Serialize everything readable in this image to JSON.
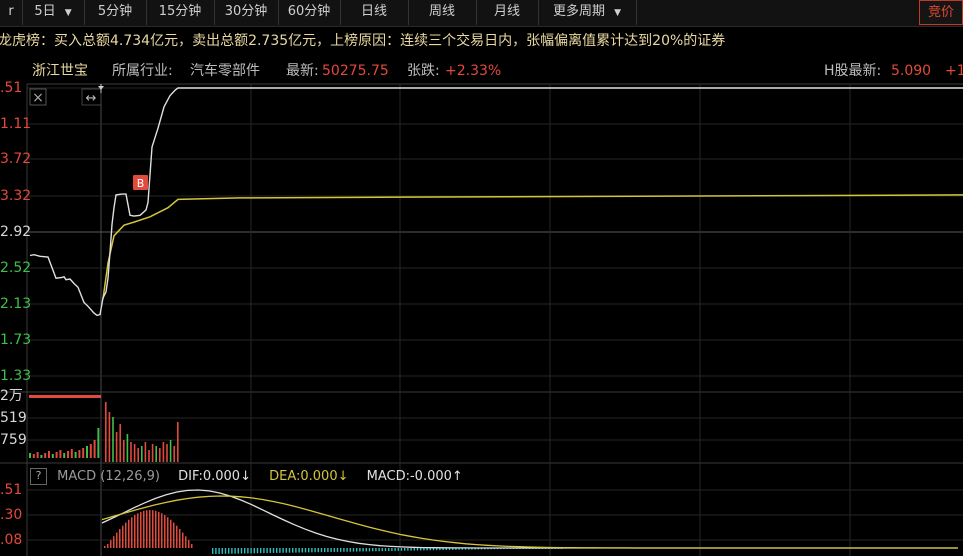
{
  "toolbar": {
    "first_fragment": "r",
    "period_selected": "5日",
    "items": [
      "5分钟",
      "15分钟",
      "30分钟",
      "60分钟",
      "日线",
      "周线",
      "月线",
      "更多周期"
    ],
    "right_button": "竞价"
  },
  "lhb": {
    "text": "龙虎榜：买入总额4.734亿元，卖出总额2.735亿元，上榜原因：连续三个交易日内，张幅偏离值累计达到20%的证券"
  },
  "stock": {
    "name": "浙江世宝",
    "industry_label": "所属行业:",
    "industry": "汽车零部件",
    "latest_label": "最新:",
    "latest": "50275.75",
    "change_label": "张跌:",
    "change": "+2.33%",
    "h_label": "H股最新:",
    "h_value": "5.090",
    "h_extra": "+1"
  },
  "price_axis": [
    ".51",
    "1.11",
    "3.72",
    "3.32",
    "2.92",
    "2.52",
    "2.13",
    "1.73",
    "1.33"
  ],
  "volume_axis": [
    "2万",
    "519",
    "759"
  ],
  "macd": {
    "label": "MACD (12,26,9)",
    "dif": "DIF:0.000↓",
    "dea": "DEA:0.000↓",
    "macd": "MACD:-0.000↑",
    "axis": [
      ".51",
      ".30",
      ".08"
    ]
  },
  "markers": {
    "buy": "B",
    "close": "×",
    "resize": "↔",
    "help": "?"
  },
  "colors": {
    "up": "#e24a3b",
    "down": "#2fbfbf",
    "avg_line": "#d4c53a",
    "price_line": "#e0e0e0",
    "lhb_text": "#e9d8a0",
    "name": "#e9d8a0"
  },
  "chart_data": {
    "type": "line",
    "title": "浙江世宝",
    "price_series": {
      "name": "price",
      "values": [
        2.92,
        2.93,
        2.91,
        2.9,
        2.62,
        2.63,
        2.64,
        2.6,
        2.61,
        2.55,
        2.5,
        2.3,
        2.25,
        2.16,
        2.13,
        2.14,
        2.36,
        2.44,
        2.62,
        2.96,
        3.33,
        3.55,
        3.72,
        3.73,
        3.73,
        3.45,
        3.44,
        3.45,
        3.52,
        3.62,
        4.35,
        4.6,
        4.88,
        5.03,
        5.1,
        5.13,
        5.13,
        5.13,
        5.13,
        5.13,
        5.13,
        5.13,
        5.13
      ]
    },
    "avg_series": {
      "name": "avg",
      "values": [
        2.35,
        2.82,
        3.18,
        3.32,
        3.36,
        3.43,
        3.55,
        3.66,
        3.68,
        3.69,
        3.7,
        3.71,
        3.72
      ]
    },
    "ylim": [
      1.33,
      5.13
    ]
  }
}
